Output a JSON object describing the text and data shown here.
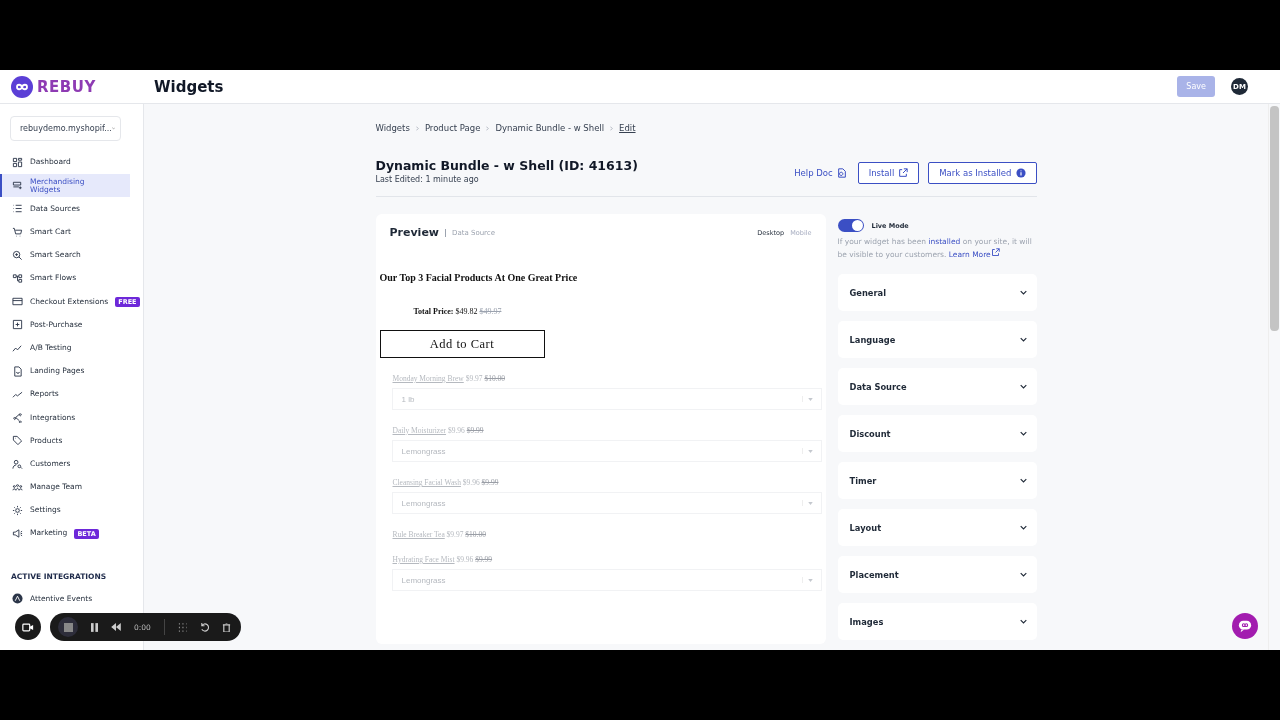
{
  "header": {
    "brand": "REBUY",
    "title": "Widgets",
    "save": {
      "label": "Save",
      "disabled": true
    },
    "avatar": "DM"
  },
  "sidebar": {
    "store": "rebuydemo.myshopif...",
    "items": [
      {
        "label": "Dashboard",
        "selected": false
      },
      {
        "label": "Merchandising Widgets",
        "selected": true
      },
      {
        "label": "Data Sources",
        "selected": false
      },
      {
        "label": "Smart Cart",
        "selected": false
      },
      {
        "label": "Smart Search",
        "selected": false
      },
      {
        "label": "Smart Flows",
        "selected": false
      },
      {
        "label": "Checkout Extensions",
        "selected": false,
        "badge": "FREE"
      },
      {
        "label": "Post-Purchase",
        "selected": false
      },
      {
        "label": "A/B Testing",
        "selected": false
      },
      {
        "label": "Landing Pages",
        "selected": false
      },
      {
        "label": "Reports",
        "selected": false
      },
      {
        "label": "Integrations",
        "selected": false
      },
      {
        "label": "Products",
        "selected": false
      },
      {
        "label": "Customers",
        "selected": false
      },
      {
        "label": "Manage Team",
        "selected": false
      },
      {
        "label": "Settings",
        "selected": false
      },
      {
        "label": "Marketing",
        "selected": false,
        "badge": "BETA"
      }
    ],
    "section_title": "ACTIVE INTEGRATIONS",
    "integrations": [
      "Attentive Events"
    ]
  },
  "breadcrumbs": [
    "Widgets",
    "Product Page",
    "Dynamic Bundle - w Shell",
    "Edit"
  ],
  "widget": {
    "title": "Dynamic Bundle - w Shell (ID: 41613)",
    "last_edited": "Last Edited: 1 minute ago",
    "help_doc": "Help Doc",
    "install": "Install",
    "mark_installed": "Mark as Installed"
  },
  "preview": {
    "title": "Preview",
    "data_source": "Data Source",
    "views": [
      {
        "label": "Desktop",
        "selected": true
      },
      {
        "label": "Mobile",
        "selected": false
      }
    ],
    "heading": "Our Top 3 Facial Products At One Great Price",
    "total_label": "Total Price:",
    "total": "$49.82",
    "total_old": "$49.97",
    "add_to_cart": "Add to Cart",
    "products": [
      {
        "name": "Monday Morning Brew",
        "price": "$9.97",
        "old_price": "$10.00",
        "variant": "1 lb"
      },
      {
        "name": "Daily Moisturizer",
        "price": "$9.96",
        "old_price": "$9.99",
        "variant": "Lemongrass"
      },
      {
        "name": "Cleansing Facial Wash",
        "price": "$9.96",
        "old_price": "$9.99",
        "variant": "Lemongrass"
      },
      {
        "name": "Rule Breaker Tea",
        "price": "$9.97",
        "old_price": "$10.00"
      },
      {
        "name": "Hydrating Face Mist",
        "price": "$9.96",
        "old_price": "$9.99",
        "variant": "Lemongrass"
      }
    ]
  },
  "live_mode": {
    "label": "Live Mode",
    "on": true,
    "note_before": "If your widget has been",
    "note_link": "installed",
    "note_after": "on your site, it will be visible to your customers.",
    "learn_more": "Learn More"
  },
  "sections": [
    {
      "label": "General",
      "expanded": false
    },
    {
      "label": "Language",
      "expanded": false
    },
    {
      "label": "Data Source",
      "expanded": false
    },
    {
      "label": "Discount",
      "expanded": false
    },
    {
      "label": "Timer",
      "expanded": false
    },
    {
      "label": "Layout",
      "expanded": false
    },
    {
      "label": "Placement",
      "expanded": false
    },
    {
      "label": "Images",
      "expanded": false
    }
  ],
  "recorder": {
    "time": "0:00"
  }
}
